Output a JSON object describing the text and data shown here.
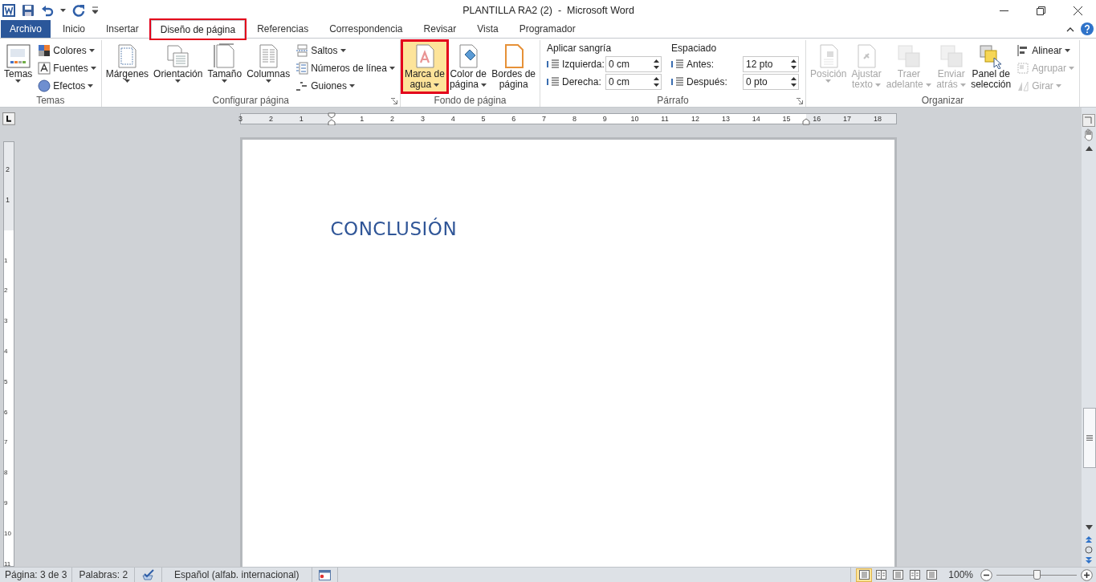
{
  "window": {
    "title": "PLANTILLA RA2 (2)  -  Microsoft Word"
  },
  "tabs": [
    {
      "label": "Archivo",
      "kind": "file",
      "selected": false,
      "highlighted": false
    },
    {
      "label": "Inicio",
      "kind": "tab",
      "selected": false,
      "highlighted": false
    },
    {
      "label": "Insertar",
      "kind": "tab",
      "selected": false,
      "highlighted": false
    },
    {
      "label": "Diseño de página",
      "kind": "tab",
      "selected": true,
      "highlighted": true
    },
    {
      "label": "Referencias",
      "kind": "tab",
      "selected": false,
      "highlighted": false
    },
    {
      "label": "Correspondencia",
      "kind": "tab",
      "selected": false,
      "highlighted": false
    },
    {
      "label": "Revisar",
      "kind": "tab",
      "selected": false,
      "highlighted": false
    },
    {
      "label": "Vista",
      "kind": "tab",
      "selected": false,
      "highlighted": false
    },
    {
      "label": "Programador",
      "kind": "tab",
      "selected": false,
      "highlighted": false
    }
  ],
  "ribbon": {
    "groups": [
      {
        "label": "Temas",
        "launcher": false,
        "columns": [
          {
            "kind": "large",
            "lines": [
              "Temas"
            ],
            "dropdown": true,
            "disabled": false,
            "highlighted": false
          },
          {
            "kind": "stack",
            "items": [
              {
                "label": "Colores",
                "dropdown": true,
                "disabled": false
              },
              {
                "label": "Fuentes",
                "dropdown": true,
                "disabled": false
              },
              {
                "label": "Efectos",
                "dropdown": true,
                "disabled": false
              }
            ]
          }
        ]
      },
      {
        "label": "Configurar página",
        "launcher": true,
        "columns": [
          {
            "kind": "large",
            "lines": [
              "Márgenes"
            ],
            "dropdown": true,
            "disabled": false,
            "highlighted": false
          },
          {
            "kind": "large",
            "lines": [
              "Orientación"
            ],
            "dropdown": true,
            "disabled": false,
            "highlighted": false
          },
          {
            "kind": "large",
            "lines": [
              "Tamaño"
            ],
            "dropdown": true,
            "disabled": false,
            "highlighted": false
          },
          {
            "kind": "large",
            "lines": [
              "Columnas"
            ],
            "dropdown": true,
            "disabled": false,
            "highlighted": false
          },
          {
            "kind": "stack",
            "items": [
              {
                "label": "Saltos",
                "dropdown": true,
                "disabled": false
              },
              {
                "label": "Números de línea",
                "dropdown": true,
                "disabled": false
              },
              {
                "label": "Guiones",
                "dropdown": true,
                "disabled": false
              }
            ]
          }
        ]
      },
      {
        "label": "Fondo de página",
        "launcher": false,
        "columns": [
          {
            "kind": "large",
            "lines": [
              "Marca de",
              "agua"
            ],
            "dropdown": true,
            "disabled": false,
            "highlighted": true
          },
          {
            "kind": "large",
            "lines": [
              "Color de",
              "página"
            ],
            "dropdown": true,
            "disabled": false,
            "highlighted": false
          },
          {
            "kind": "large",
            "lines": [
              "Bordes de",
              "página"
            ],
            "dropdown": false,
            "disabled": false,
            "highlighted": false
          }
        ]
      },
      {
        "label": "Párrafo",
        "launcher": true,
        "columns": [
          {
            "kind": "spin",
            "heading": "Aplicar sangría",
            "fields": [
              {
                "label": "Izquierda:",
                "value": "0 cm"
              },
              {
                "label": "Derecha:",
                "value": "0 cm"
              }
            ]
          },
          {
            "kind": "spin",
            "heading": "Espaciado",
            "fields": [
              {
                "label": "Antes:",
                "value": "12 pto"
              },
              {
                "label": "Después:",
                "value": "0 pto"
              }
            ]
          }
        ]
      },
      {
        "label": "Organizar",
        "launcher": false,
        "columns": [
          {
            "kind": "large",
            "lines": [
              "Posición"
            ],
            "dropdown": true,
            "disabled": true,
            "highlighted": false
          },
          {
            "kind": "large",
            "lines": [
              "Ajustar",
              "texto"
            ],
            "dropdown": true,
            "disabled": true,
            "highlighted": false
          },
          {
            "kind": "large",
            "lines": [
              "Traer",
              "adelante"
            ],
            "dropdown": true,
            "disabled": true,
            "highlighted": false
          },
          {
            "kind": "large",
            "lines": [
              "Enviar",
              "atrás"
            ],
            "dropdown": true,
            "disabled": true,
            "highlighted": false
          },
          {
            "kind": "large",
            "lines": [
              "Panel de",
              "selección"
            ],
            "dropdown": false,
            "disabled": false,
            "highlighted": false
          },
          {
            "kind": "stack",
            "items": [
              {
                "label": "Alinear",
                "dropdown": true,
                "disabled": false
              },
              {
                "label": "Agrupar",
                "dropdown": true,
                "disabled": true
              },
              {
                "label": "Girar",
                "dropdown": true,
                "disabled": true
              }
            ]
          }
        ]
      }
    ]
  },
  "ruler": {
    "before": [
      "3",
      "2",
      "1"
    ],
    "after": [
      "1",
      "2",
      "3",
      "4",
      "5",
      "6",
      "7",
      "8",
      "9",
      "10",
      "11",
      "12",
      "13",
      "14",
      "15",
      "16",
      "17",
      "18"
    ]
  },
  "vertical_ruler": {
    "before": [
      "2",
      "1"
    ],
    "after": [
      "1",
      "2",
      "3",
      "4",
      "5",
      "6",
      "7",
      "8",
      "9",
      "10",
      "11"
    ]
  },
  "document": {
    "heading": "CONCLUSIÓN"
  },
  "status_bar": {
    "page": "Página: 3 de 3",
    "words": "Palabras: 2",
    "language": "Español (alfab. internacional)",
    "views": [
      {
        "selected": true
      },
      {
        "selected": false
      },
      {
        "selected": false
      },
      {
        "selected": false
      },
      {
        "selected": false
      }
    ],
    "zoom": "100%",
    "zoom_slider": {
      "level": 0.5
    }
  }
}
